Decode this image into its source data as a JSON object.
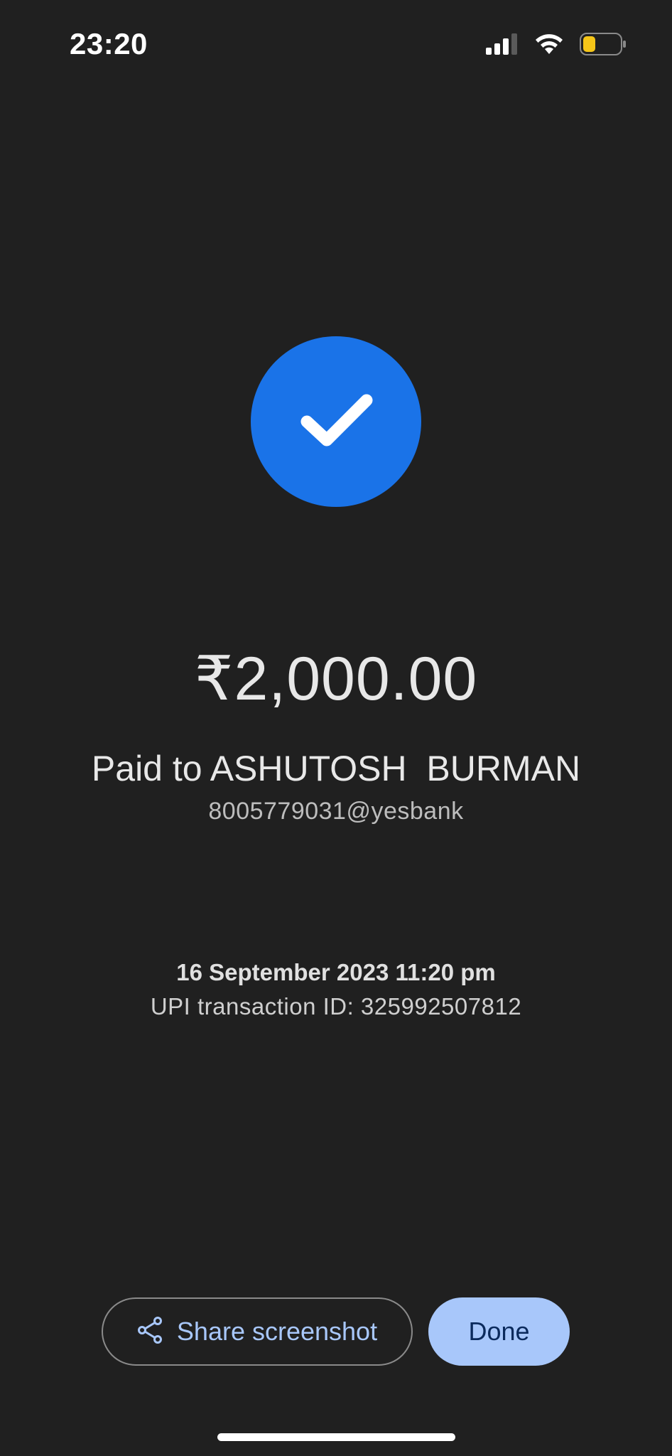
{
  "status_bar": {
    "time": "23:20",
    "signal_icon": "cellular-signal-icon",
    "wifi_icon": "wifi-icon",
    "battery_icon": "battery-icon",
    "battery_color": "#f5c518"
  },
  "success": {
    "icon": "check-icon",
    "accent_color": "#1a73e8"
  },
  "payment": {
    "amount": "₹2,000.00",
    "paid_to": "Paid to ASHUTOSH  BURMAN",
    "upi_id": "8005779031@yesbank"
  },
  "transaction": {
    "date_time": "16 September 2023 11:20 pm",
    "upi_txn_id": "UPI transaction ID: 325992507812"
  },
  "actions": {
    "share_label": "Share screenshot",
    "share_icon": "share-icon",
    "done_label": "Done"
  }
}
